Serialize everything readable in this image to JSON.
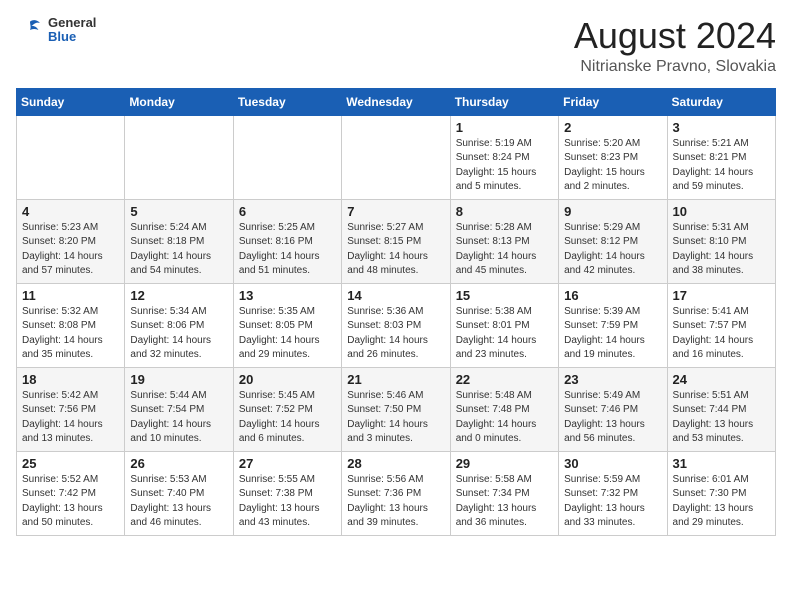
{
  "header": {
    "logo": {
      "general": "General",
      "blue": "Blue"
    },
    "title": "August 2024",
    "location": "Nitrianske Pravno, Slovakia"
  },
  "weekdays": [
    "Sunday",
    "Monday",
    "Tuesday",
    "Wednesday",
    "Thursday",
    "Friday",
    "Saturday"
  ],
  "weeks": [
    [
      {
        "day": "",
        "info": ""
      },
      {
        "day": "",
        "info": ""
      },
      {
        "day": "",
        "info": ""
      },
      {
        "day": "",
        "info": ""
      },
      {
        "day": "1",
        "info": "Sunrise: 5:19 AM\nSunset: 8:24 PM\nDaylight: 15 hours\nand 5 minutes."
      },
      {
        "day": "2",
        "info": "Sunrise: 5:20 AM\nSunset: 8:23 PM\nDaylight: 15 hours\nand 2 minutes."
      },
      {
        "day": "3",
        "info": "Sunrise: 5:21 AM\nSunset: 8:21 PM\nDaylight: 14 hours\nand 59 minutes."
      }
    ],
    [
      {
        "day": "4",
        "info": "Sunrise: 5:23 AM\nSunset: 8:20 PM\nDaylight: 14 hours\nand 57 minutes."
      },
      {
        "day": "5",
        "info": "Sunrise: 5:24 AM\nSunset: 8:18 PM\nDaylight: 14 hours\nand 54 minutes."
      },
      {
        "day": "6",
        "info": "Sunrise: 5:25 AM\nSunset: 8:16 PM\nDaylight: 14 hours\nand 51 minutes."
      },
      {
        "day": "7",
        "info": "Sunrise: 5:27 AM\nSunset: 8:15 PM\nDaylight: 14 hours\nand 48 minutes."
      },
      {
        "day": "8",
        "info": "Sunrise: 5:28 AM\nSunset: 8:13 PM\nDaylight: 14 hours\nand 45 minutes."
      },
      {
        "day": "9",
        "info": "Sunrise: 5:29 AM\nSunset: 8:12 PM\nDaylight: 14 hours\nand 42 minutes."
      },
      {
        "day": "10",
        "info": "Sunrise: 5:31 AM\nSunset: 8:10 PM\nDaylight: 14 hours\nand 38 minutes."
      }
    ],
    [
      {
        "day": "11",
        "info": "Sunrise: 5:32 AM\nSunset: 8:08 PM\nDaylight: 14 hours\nand 35 minutes."
      },
      {
        "day": "12",
        "info": "Sunrise: 5:34 AM\nSunset: 8:06 PM\nDaylight: 14 hours\nand 32 minutes."
      },
      {
        "day": "13",
        "info": "Sunrise: 5:35 AM\nSunset: 8:05 PM\nDaylight: 14 hours\nand 29 minutes."
      },
      {
        "day": "14",
        "info": "Sunrise: 5:36 AM\nSunset: 8:03 PM\nDaylight: 14 hours\nand 26 minutes."
      },
      {
        "day": "15",
        "info": "Sunrise: 5:38 AM\nSunset: 8:01 PM\nDaylight: 14 hours\nand 23 minutes."
      },
      {
        "day": "16",
        "info": "Sunrise: 5:39 AM\nSunset: 7:59 PM\nDaylight: 14 hours\nand 19 minutes."
      },
      {
        "day": "17",
        "info": "Sunrise: 5:41 AM\nSunset: 7:57 PM\nDaylight: 14 hours\nand 16 minutes."
      }
    ],
    [
      {
        "day": "18",
        "info": "Sunrise: 5:42 AM\nSunset: 7:56 PM\nDaylight: 14 hours\nand 13 minutes."
      },
      {
        "day": "19",
        "info": "Sunrise: 5:44 AM\nSunset: 7:54 PM\nDaylight: 14 hours\nand 10 minutes."
      },
      {
        "day": "20",
        "info": "Sunrise: 5:45 AM\nSunset: 7:52 PM\nDaylight: 14 hours\nand 6 minutes."
      },
      {
        "day": "21",
        "info": "Sunrise: 5:46 AM\nSunset: 7:50 PM\nDaylight: 14 hours\nand 3 minutes."
      },
      {
        "day": "22",
        "info": "Sunrise: 5:48 AM\nSunset: 7:48 PM\nDaylight: 14 hours\nand 0 minutes."
      },
      {
        "day": "23",
        "info": "Sunrise: 5:49 AM\nSunset: 7:46 PM\nDaylight: 13 hours\nand 56 minutes."
      },
      {
        "day": "24",
        "info": "Sunrise: 5:51 AM\nSunset: 7:44 PM\nDaylight: 13 hours\nand 53 minutes."
      }
    ],
    [
      {
        "day": "25",
        "info": "Sunrise: 5:52 AM\nSunset: 7:42 PM\nDaylight: 13 hours\nand 50 minutes."
      },
      {
        "day": "26",
        "info": "Sunrise: 5:53 AM\nSunset: 7:40 PM\nDaylight: 13 hours\nand 46 minutes."
      },
      {
        "day": "27",
        "info": "Sunrise: 5:55 AM\nSunset: 7:38 PM\nDaylight: 13 hours\nand 43 minutes."
      },
      {
        "day": "28",
        "info": "Sunrise: 5:56 AM\nSunset: 7:36 PM\nDaylight: 13 hours\nand 39 minutes."
      },
      {
        "day": "29",
        "info": "Sunrise: 5:58 AM\nSunset: 7:34 PM\nDaylight: 13 hours\nand 36 minutes."
      },
      {
        "day": "30",
        "info": "Sunrise: 5:59 AM\nSunset: 7:32 PM\nDaylight: 13 hours\nand 33 minutes."
      },
      {
        "day": "31",
        "info": "Sunrise: 6:01 AM\nSunset: 7:30 PM\nDaylight: 13 hours\nand 29 minutes."
      }
    ]
  ]
}
